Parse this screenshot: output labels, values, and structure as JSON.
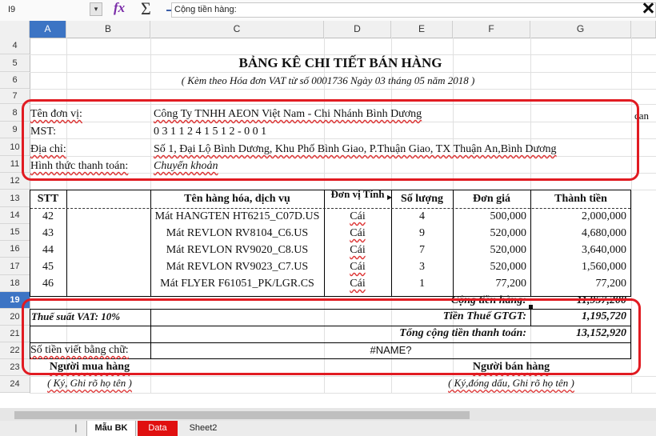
{
  "formula_bar": {
    "cell_ref": "I9",
    "fx_icon": "fx-icon",
    "sum_icon": "sigma-icon",
    "equals_icon": "equals-icon",
    "content": "Cộng tiền hàng:"
  },
  "columns": [
    "A",
    "B",
    "C",
    "D",
    "E",
    "F",
    "G"
  ],
  "selected_column": "A",
  "rows": [
    "4",
    "5",
    "6",
    "7",
    "8",
    "9",
    "10",
    "11",
    "12",
    "13",
    "14",
    "15",
    "16",
    "17",
    "18",
    "19",
    "20",
    "21",
    "22",
    "23",
    "24"
  ],
  "selected_row": "19",
  "doc": {
    "title": "BẢNG KÊ CHI TIẾT BÁN HÀNG",
    "subtitle": "( Kèm theo Hóa đơn VAT từ số 0001736 Ngày 03 tháng 05 năm 2018 )",
    "unit_label": "Tên đơn vị:",
    "unit_value": "Công Ty TNHH AEON Việt Nam - Chi Nhánh Bình Dương",
    "unit_overflow": "can",
    "tax_label": "MST:",
    "tax_value": "0 3 1 1 2 4 1 5 1 2 - 0 0 1",
    "address_label": "Địa chỉ:",
    "address_value": "Số 1, Đại Lộ Bình Dương, Khu Phố Bình Giao, P.Thuận Giao, TX Thuận An,Bình Dương",
    "payment_label": "Hình thức thanh toán:",
    "payment_value": "Chuyển khoản",
    "table_headers": [
      "STT",
      "Tên hàng hóa, dịch vụ",
      "Đơn vị Tính",
      "Số lượng",
      "Đơn giá",
      "Thành tiền"
    ],
    "items": [
      {
        "stt": "42",
        "name": "Mát HANGTEN HT6215_C07D.US",
        "unit": "Cái",
        "qty": "4",
        "price": "500,000",
        "total": "2,000,000"
      },
      {
        "stt": "43",
        "name": "Mát REVLON RV8104_C6.US",
        "unit": "Cái",
        "qty": "9",
        "price": "520,000",
        "total": "4,680,000"
      },
      {
        "stt": "44",
        "name": "Mát REVLON RV9020_C8.US",
        "unit": "Cái",
        "qty": "7",
        "price": "520,000",
        "total": "3,640,000"
      },
      {
        "stt": "45",
        "name": "Mát REVLON RV9023_C7.US",
        "unit": "Cái",
        "qty": "3",
        "price": "520,000",
        "total": "1,560,000"
      },
      {
        "stt": "46",
        "name": "Mát FLYER F61051_PK/LGR.CS",
        "unit": "Cái",
        "qty": "1",
        "price": "77,200",
        "total": "77,200"
      }
    ],
    "subtotal_label": "Cộng tiền hàng:",
    "subtotal_value": "11,957,200",
    "vat_rate": "Thuế suất VAT: 10%",
    "vat_label": "Tiền Thuế GTGT:",
    "vat_value": "1,195,720",
    "grand_label": "Tổng cộng tiền thanh toán:",
    "grand_value": "13,152,920",
    "words_label": "Số tiền viết bằng chữ:",
    "words_value": "#NAME?",
    "buyer": "Người mua hàng",
    "buyer_note": "( Ký, Ghi rõ họ tên )",
    "seller": "Người bán hàng",
    "seller_note": "( Ký,đóng dấu,  Ghi rõ họ tên )"
  },
  "sheet_tabs": [
    "Mẫu BK",
    "Data",
    "Sheet2"
  ],
  "tab_nav_icon": "tab-scroll-icon",
  "annotation_color": "#e11b22"
}
